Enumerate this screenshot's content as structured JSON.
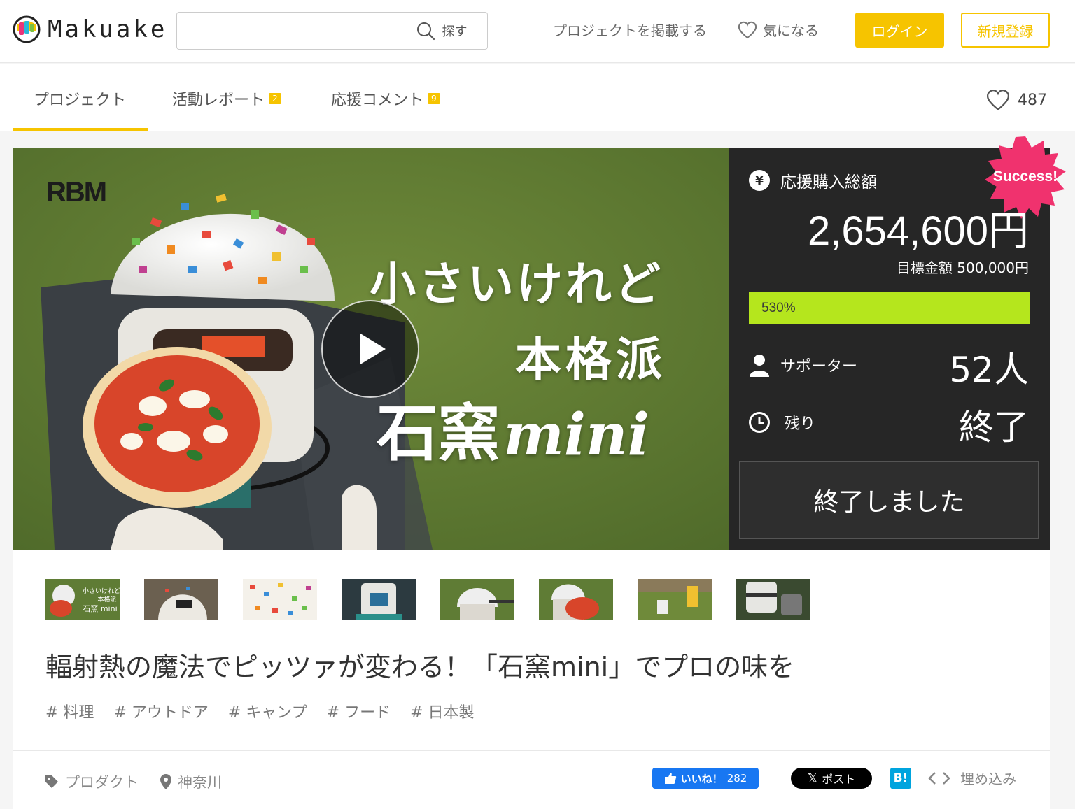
{
  "header": {
    "logo_text": "Makuake",
    "search": {
      "placeholder": "",
      "button_label": "探す"
    },
    "post_project_label": "プロジェクトを掲載する",
    "favorite_label": "気になる",
    "login_label": "ログイン",
    "register_label": "新規登録"
  },
  "tabs": {
    "items": [
      {
        "label": "プロジェクト",
        "badge": ""
      },
      {
        "label": "活動レポート",
        "badge": "2"
      },
      {
        "label": "応援コメント",
        "badge": "9"
      }
    ],
    "favorite_count": "487"
  },
  "hero": {
    "brand_mark": "RBM",
    "catch_line1": "小さいけれど",
    "catch_line2": "本格派",
    "product_name_jp": "石窯",
    "product_name_en": "mini"
  },
  "stats": {
    "badge": "Success!",
    "total_label": "応援購入総額",
    "total_amount": "2,654,600円",
    "goal_text": "目標金額 500,000円",
    "progress_label": "530%",
    "progress_fraction": 1.0,
    "supporters_label": "サポーター",
    "supporters_value": "52人",
    "remaining_label": "残り",
    "remaining_value": "終了",
    "ended_button_label": "終了しました"
  },
  "thumb_text": {
    "line1": "小さいけれど",
    "line2": "本格派",
    "line3": "石窯 mini"
  },
  "project": {
    "title": "輻射熱の魔法でピッツァが変わる！「石窯mini」でプロの味を",
    "tags": [
      "# 料理",
      "# アウトドア",
      "# キャンプ",
      "# フード",
      "# 日本製"
    ],
    "category": "プロダクト",
    "location": "神奈川"
  },
  "share": {
    "like_label": "いいね！",
    "like_count": "282",
    "x_label": "ポスト",
    "hatena_label": "B!",
    "embed_label": "埋め込み"
  },
  "colors": {
    "accent": "#f6c400",
    "progress": "#b5e61d",
    "stats_bg": "#262626",
    "success_badge": "#f0326e"
  }
}
